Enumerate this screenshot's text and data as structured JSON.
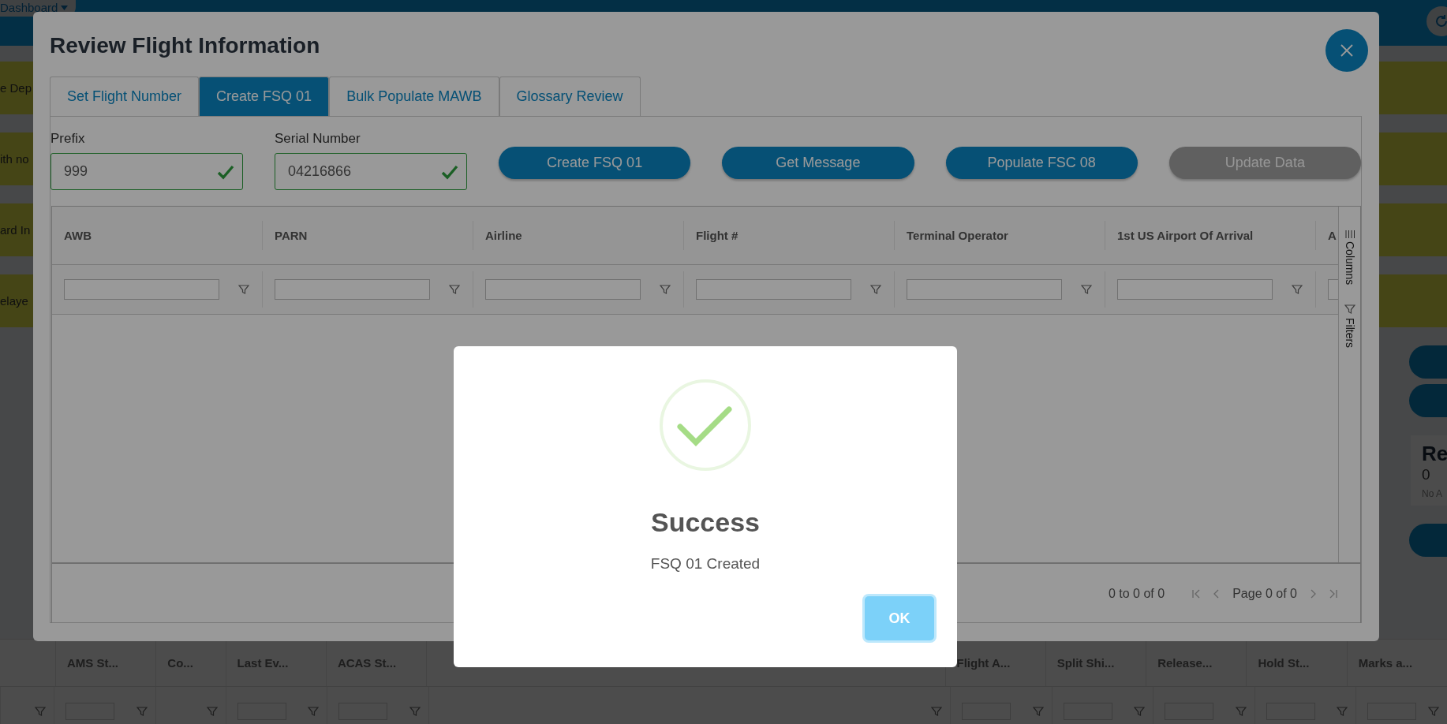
{
  "nav": {
    "tab": "Dashboard"
  },
  "left_cards": [
    "e Dep",
    "ith no",
    "ard In",
    "elaye"
  ],
  "summary_card": {
    "title": "Re",
    "count": "0",
    "note": "No A"
  },
  "background_table": {
    "columns_left": [
      "AMS St...",
      "Co...",
      "Last Ev...",
      "ACAS St..."
    ],
    "columns_right": [
      "Flight A...",
      "Split Shi...",
      "Release...",
      "Hold St...",
      "Marks a..."
    ]
  },
  "modal": {
    "title": "Review Flight Information",
    "tabs": [
      {
        "label": "Set Flight Number",
        "selected": false
      },
      {
        "label": "Create FSQ 01",
        "selected": true
      },
      {
        "label": "Bulk Populate MAWB",
        "selected": false
      },
      {
        "label": "Glossary Review",
        "selected": false
      }
    ],
    "fields": [
      {
        "label": "Prefix",
        "value": "999",
        "valid": true
      },
      {
        "label": "Serial Number",
        "value": "04216866",
        "valid": true
      }
    ],
    "buttons": [
      {
        "label": "Create FSQ 01",
        "disabled": false
      },
      {
        "label": "Get Message",
        "disabled": false
      },
      {
        "label": "Populate FSC 08",
        "disabled": false
      },
      {
        "label": "Update Data",
        "disabled": true
      }
    ],
    "grid": {
      "columns": [
        "AWB",
        "PARN",
        "Airline",
        "Flight #",
        "Terminal Operator",
        "1st US Airport Of Arrival",
        "A"
      ],
      "side_panel": [
        "Columns",
        "Filters"
      ],
      "footer": {
        "range": "0 to 0 of 0",
        "page": "Page 0 of 0"
      }
    }
  },
  "dialog": {
    "title": "Success",
    "message": "FSQ 01 Created",
    "button": "OK"
  }
}
